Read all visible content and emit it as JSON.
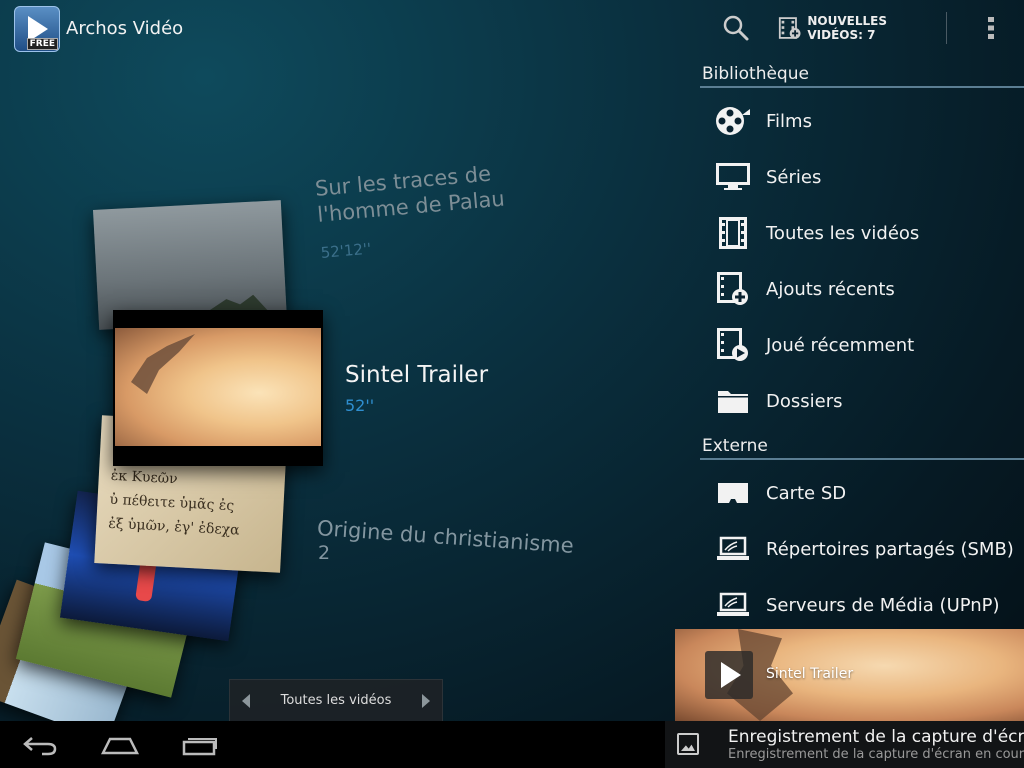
{
  "app": {
    "title": "Archos Vidéo",
    "badge": "FREE",
    "icon": "archos-video-app-icon"
  },
  "actionbar": {
    "search_icon": "search-icon",
    "new_videos_label": "NOUVELLES VIDÉOS: 7",
    "new_videos_icon": "film-add-icon",
    "overflow_icon": "overflow-menu-icon"
  },
  "coverflow": {
    "above": {
      "title": "Sur les traces de l'homme de Palau",
      "duration": "52'12''"
    },
    "current": {
      "title": "Sintel Trailer",
      "duration": "52''"
    },
    "below": {
      "title": "Origine du christianisme",
      "count": "2"
    },
    "script_text": [
      "ἐκ Κυεῶν",
      "ὐ πέθειτε ὑμᾶς ἐς",
      "ἐξ ὑμῶν, ἐγ' ἐδεχα"
    ]
  },
  "selector": {
    "label": "Toutes les vidéos"
  },
  "sidebar": {
    "sections": [
      {
        "header": "Bibliothèque"
      },
      {
        "header": "Externe"
      }
    ],
    "library_items": [
      {
        "label": "Films",
        "icon": "film-reel-icon"
      },
      {
        "label": "Séries",
        "icon": "tv-monitor-icon"
      },
      {
        "label": "Toutes les vidéos",
        "icon": "film-strip-icon"
      },
      {
        "label": "Ajouts récents",
        "icon": "film-add-icon"
      },
      {
        "label": "Joué récemment",
        "icon": "film-play-icon"
      },
      {
        "label": "Dossiers",
        "icon": "folder-icon"
      }
    ],
    "external_items": [
      {
        "label": "Carte SD",
        "icon": "sd-card-icon"
      },
      {
        "label": "Répertoires partagés (SMB)",
        "icon": "laptop-network-icon"
      },
      {
        "label": "Serveurs de Média (UPnP)",
        "icon": "laptop-network-icon"
      }
    ]
  },
  "now_playing": {
    "title": "Sintel Trailer"
  },
  "notification": {
    "title": "Enregistrement de la capture d'écran...",
    "subtitle": "Enregistrement de la capture d'écran en cours..."
  },
  "systembar": {
    "back_icon": "back-icon",
    "home_icon": "home-icon",
    "recents_icon": "recent-apps-icon"
  }
}
